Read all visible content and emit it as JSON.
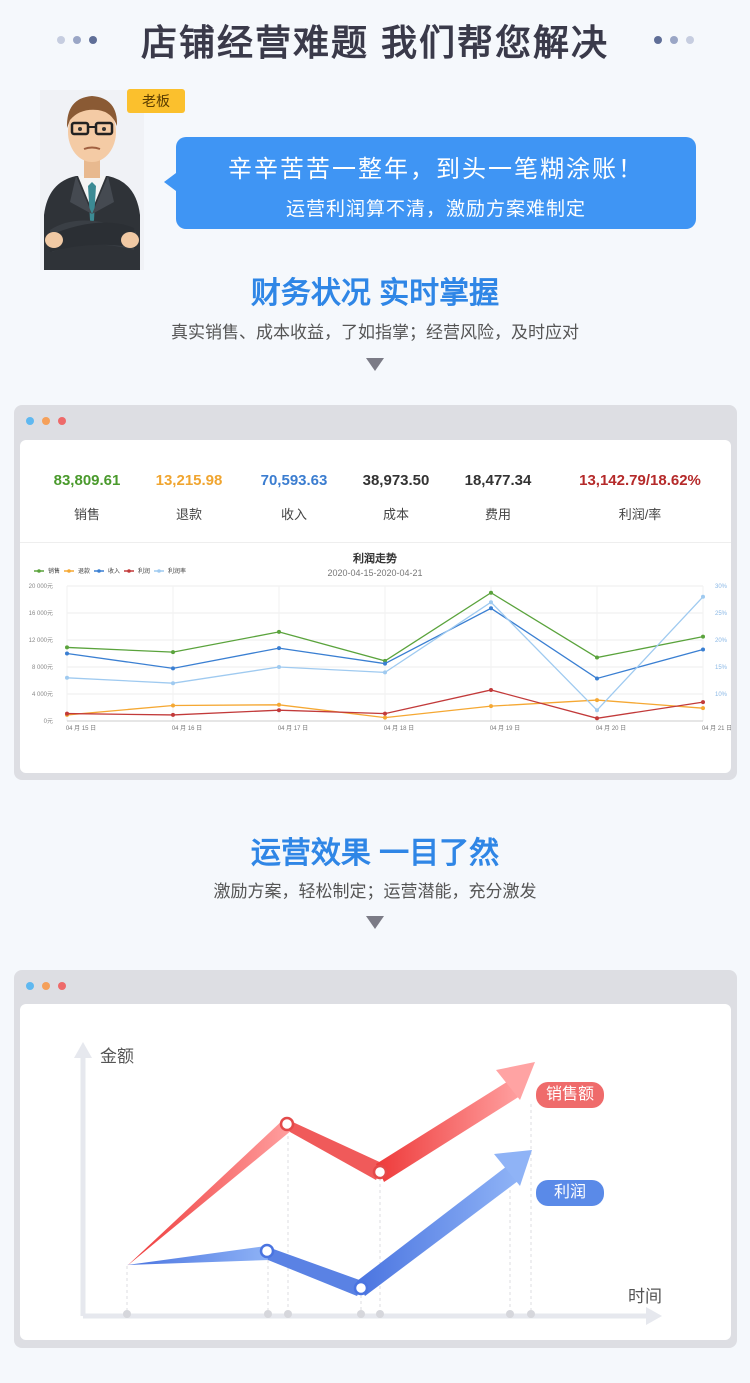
{
  "header": {
    "title": "店铺经营难题 我们帮您解决",
    "dot_colors": [
      "#c6cde0",
      "#9aa6c6",
      "#5f6e97"
    ]
  },
  "boss": {
    "tag": "老板",
    "bubble_line1": "辛辛苦苦一整年，到头一笔糊涂账！",
    "bubble_line2": "运营利润算不清，激励方案难制定"
  },
  "section1": {
    "title": "财务状况 实时掌握",
    "subtitle": "真实销售、成本收益，了如指掌；经营风险，及时应对"
  },
  "window_dots": [
    "#5fb8f0",
    "#f5a05a",
    "#ee6a6a"
  ],
  "stats": [
    {
      "value": "83,809.61",
      "label": "销售",
      "color": "#4a9a2c"
    },
    {
      "value": "13,215.98",
      "label": "退款",
      "color": "#f0a530"
    },
    {
      "value": "70,593.63",
      "label": "收入",
      "color": "#3b7dd0"
    },
    {
      "value": "38,973.50",
      "label": "成本",
      "color": "#333333"
    },
    {
      "value": "18,477.34",
      "label": "费用",
      "color": "#333333"
    },
    {
      "value": "13,142.79/18.62%",
      "label": "利润/率",
      "color": "#b52a2a"
    }
  ],
  "chart_data": {
    "type": "line",
    "title": "利润走势",
    "subtitle": "2020-04-15-2020-04-21",
    "categories": [
      "04 月 15 日",
      "04 月 16 日",
      "04 月 17 日",
      "04 月 18 日",
      "04 月 19 日",
      "04 月 20 日",
      "04 月 21 日"
    ],
    "y_ticks": [
      "0元",
      "4 000元",
      "8 000元",
      "12 000元",
      "16 000元",
      "20 000元"
    ],
    "y2_ticks": [
      "10%",
      "15%",
      "20%",
      "25%",
      "30%"
    ],
    "ylim": [
      0,
      20000
    ],
    "y2lim": [
      5,
      30
    ],
    "grid": true,
    "legend_position": "top-left",
    "series": [
      {
        "name": "销售",
        "color": "#5aa33c",
        "axis": "left",
        "values": [
          10900,
          10200,
          13200,
          8900,
          19000,
          9400,
          12500
        ]
      },
      {
        "name": "退款",
        "color": "#f5a833",
        "axis": "left",
        "values": [
          900,
          2300,
          2400,
          500,
          2200,
          3100,
          1900
        ]
      },
      {
        "name": "收入",
        "color": "#3a7fd2",
        "axis": "left",
        "values": [
          10000,
          7800,
          10800,
          8500,
          16700,
          6300,
          10600
        ]
      },
      {
        "name": "利润",
        "color": "#c23a3a",
        "axis": "left",
        "values": [
          1100,
          900,
          1600,
          1100,
          4600,
          400,
          2800
        ]
      },
      {
        "name": "利润率",
        "color": "#9fcaf0",
        "axis": "right",
        "values": [
          13,
          12,
          15,
          14,
          27,
          7,
          28
        ]
      }
    ]
  },
  "section2": {
    "title": "运营效果 一目了然",
    "subtitle": "激励方案，轻松制定；运营潜能，充分激发"
  },
  "trend": {
    "y_label": "金额",
    "x_label": "时间",
    "sales_label": "销售额",
    "profit_label": "利润",
    "sales_color": "#ef6b6b",
    "profit_color": "#5a8ae8"
  }
}
